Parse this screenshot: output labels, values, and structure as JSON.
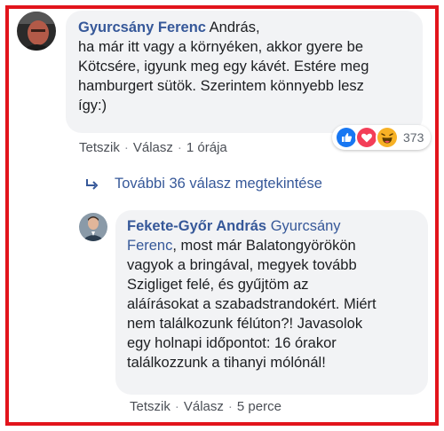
{
  "comment1": {
    "author": "Gyurcsány Ferenc",
    "lines": [
      " András,",
      "ha már itt vagy a környéken, akkor gyere be",
      "Kötcsére, igyunk meg egy kávét. Estére meg",
      "hamburgert sütök. Szerintem könnyebb lesz",
      "így:)"
    ],
    "actions": {
      "like": "Tetszik",
      "reply": "Válasz",
      "time": "1 órája"
    },
    "reactions": {
      "icons": [
        "like-icon",
        "love-icon",
        "haha-icon"
      ],
      "count": "373"
    }
  },
  "view_more": {
    "label": "További 36 válasz megtekintése"
  },
  "comment2": {
    "author": "Fekete-Győr András",
    "mention_line1": "Gyurcsány",
    "mention_line2": "Ferenc",
    "lines": [
      ", most már Balatongyörökön",
      "vagyok a bringával, megyek tovább",
      "Szigliget felé, és gyűjtöm az",
      "aláírásokat a szabadstrandokért. Miért",
      "nem találkozunk félúton?! Javasolok",
      "egy holnapi időpontot: 16 órakor",
      "találkozzunk a tihanyi mólónál!"
    ],
    "actions": {
      "like": "Tetszik",
      "reply": "Válasz",
      "time": "5 perce"
    }
  },
  "colors": {
    "frame": "#e2141c",
    "link": "#365899",
    "bubble": "#f2f3f5",
    "meta": "#606770"
  }
}
